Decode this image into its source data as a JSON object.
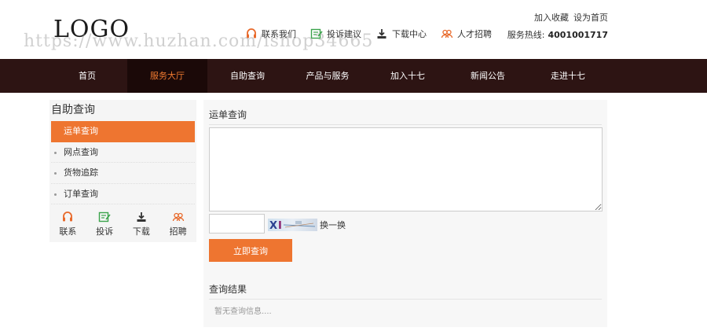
{
  "header": {
    "logo": "LOGO",
    "watermark": "https://www.huzhan.com/ishop34665",
    "top_links": [
      {
        "label": "联系我们",
        "icon": "headset-icon"
      },
      {
        "label": "投诉建议",
        "icon": "edit-icon"
      },
      {
        "label": "下载中心",
        "icon": "download-icon"
      },
      {
        "label": "人才招聘",
        "icon": "people-icon"
      }
    ],
    "add_favorite": "加入收藏",
    "set_homepage": "设为首页",
    "hotline_label": "服务热线:",
    "hotline_number": "4001001717"
  },
  "nav": {
    "items": [
      "首页",
      "服务大厅",
      "自助查询",
      "产品与服务",
      "加入十七",
      "新闻公告",
      "走进十七"
    ],
    "active_index": 1
  },
  "sidebar": {
    "title": "自助查询",
    "items": [
      "运单查询",
      "网点查询",
      "货物追踪",
      "订单查询"
    ],
    "active_index": 0,
    "icons": [
      {
        "label": "联系",
        "icon": "headset-icon"
      },
      {
        "label": "投诉",
        "icon": "edit-icon"
      },
      {
        "label": "下载",
        "icon": "download-icon"
      },
      {
        "label": "招聘",
        "icon": "people-icon"
      }
    ]
  },
  "main": {
    "query_title": "运单查询",
    "captcha_refresh": "换一换",
    "submit_label": "立即查询",
    "result_title": "查询结果",
    "result_empty": "暂无查询信息...."
  },
  "colors": {
    "accent": "#ee7530",
    "nav_bg": "#2d1413",
    "nav_active_bg": "#1b0908",
    "nav_active_text": "#f07a30",
    "icon_orange": "#e8692a",
    "icon_green": "#3aa34b"
  }
}
